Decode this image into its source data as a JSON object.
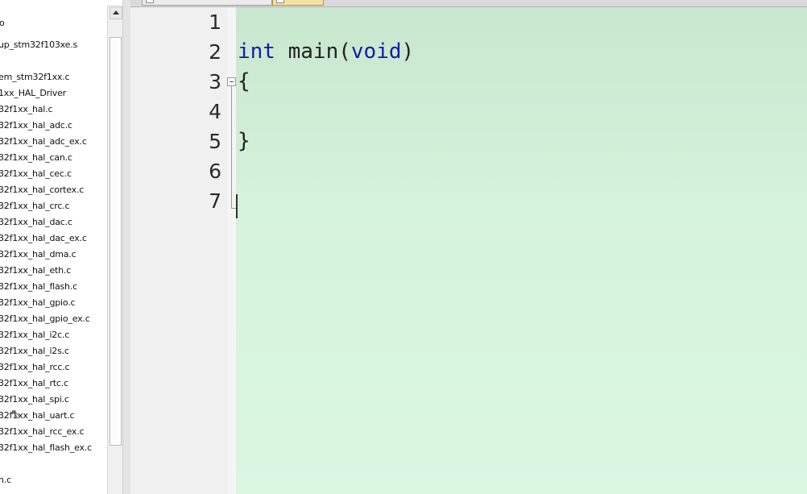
{
  "tree": {
    "top_label": "o",
    "items": [
      "up_stm32f103xe.s",
      "em_stm32f1xx.c",
      "1xx_HAL_Driver",
      "32f1xx_hal.c",
      "32f1xx_hal_adc.c",
      "32f1xx_hal_adc_ex.c",
      "32f1xx_hal_can.c",
      "32f1xx_hal_cec.c",
      "32f1xx_hal_cortex.c",
      "32f1xx_hal_crc.c",
      "32f1xx_hal_dac.c",
      "32f1xx_hal_dac_ex.c",
      "32f1xx_hal_dma.c",
      "32f1xx_hal_eth.c",
      "32f1xx_hal_flash.c",
      "32f1xx_hal_gpio.c",
      "32f1xx_hal_gpio_ex.c",
      "32f1xx_hal_i2c.c",
      "32f1xx_hal_i2s.c",
      "32f1xx_hal_rcc.c",
      "32f1xx_hal_rtc.c",
      "32f1xx_hal_spi.c",
      "32f1xx_hal_uart.c",
      "32f1xx_hal_rcc_ex.c",
      "32f1xx_hal_flash_ex.c",
      "n.c"
    ]
  },
  "editor": {
    "line_numbers": [
      "1",
      "2",
      "3",
      "4",
      "5",
      "6",
      "7"
    ],
    "code": {
      "line2_kw1": "int",
      "line2_text": " main(",
      "line2_kw2": "void",
      "line2_close": ")",
      "line3": "{",
      "line5": "}"
    }
  },
  "colors": {
    "editor_background": "#d8f5df",
    "keyword": "#1a1aa6",
    "active_tab": "#f3e3a2"
  },
  "icons": [
    "scroll-up-arrow-icon",
    "fold-collapse-icon",
    "file-tab-icon",
    "mouse-pointer-icon"
  ]
}
